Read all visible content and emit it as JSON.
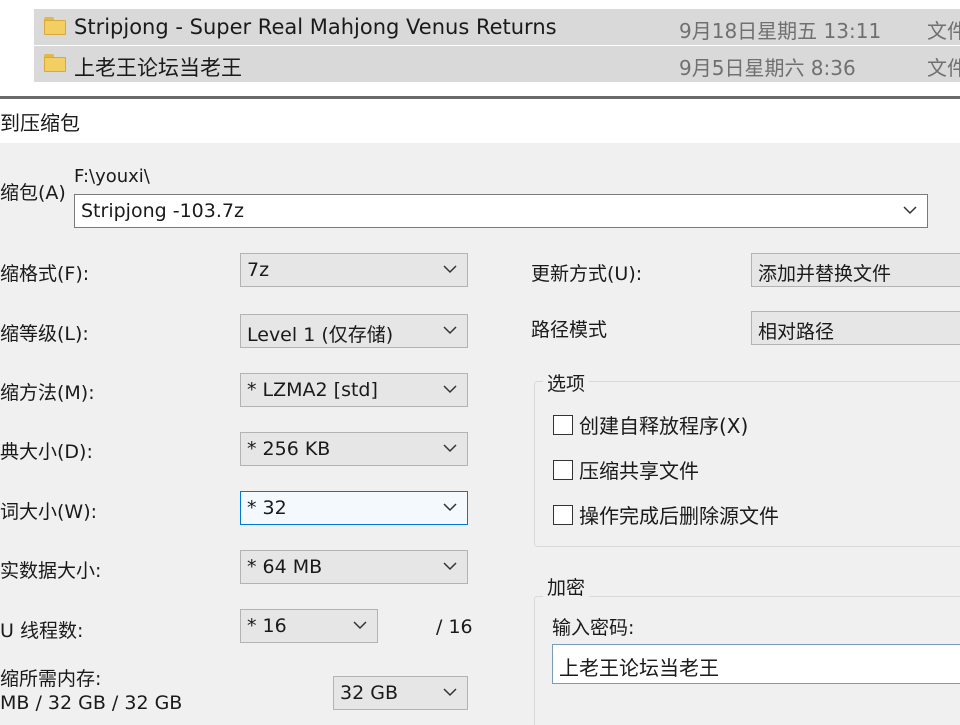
{
  "explorer": {
    "files": [
      {
        "name": "Stripjong - Super Real Mahjong Venus Returns",
        "date": "9月18日星期五 13:11",
        "type": "文件"
      },
      {
        "name": "上老王论坛当老王",
        "date": "9月5日星期六 8:36",
        "type": "文件"
      }
    ]
  },
  "dialog": {
    "title": "到压缩包",
    "archive": {
      "label": "缩包(A)",
      "path": "F:\\youxi\\",
      "filename": "Stripjong -103.7z"
    },
    "format": {
      "label": "缩格式(F):",
      "value": "7z"
    },
    "level": {
      "label": "缩等级(L):",
      "value": "Level 1 (仅存储)"
    },
    "method": {
      "label": "缩方法(M):",
      "value": "* LZMA2 [std]"
    },
    "dict_size": {
      "label": "典大小(D):",
      "value": "* 256 KB"
    },
    "word_size": {
      "label": "词大小(W):",
      "value": "* 32"
    },
    "solid_block": {
      "label": "实数据大小:",
      "value": "* 64 MB"
    },
    "threads": {
      "label": "U 线程数:",
      "value": "* 16",
      "max": "/ 16"
    },
    "memory": {
      "label": "缩所需内存:",
      "values": "MB / 32 GB / 32 GB",
      "limit": "32 GB"
    },
    "update_mode": {
      "label": "更新方式(U):",
      "value": "添加并替换文件"
    },
    "path_mode": {
      "label": "路径模式",
      "value": "相对路径"
    },
    "options": {
      "title": "选项",
      "items": [
        "创建自释放程序(X)",
        "压缩共享文件",
        "操作完成后删除源文件"
      ]
    },
    "encryption": {
      "title": "加密",
      "password_label": "输入密码:",
      "password_value": "上老王论坛当老王"
    }
  }
}
